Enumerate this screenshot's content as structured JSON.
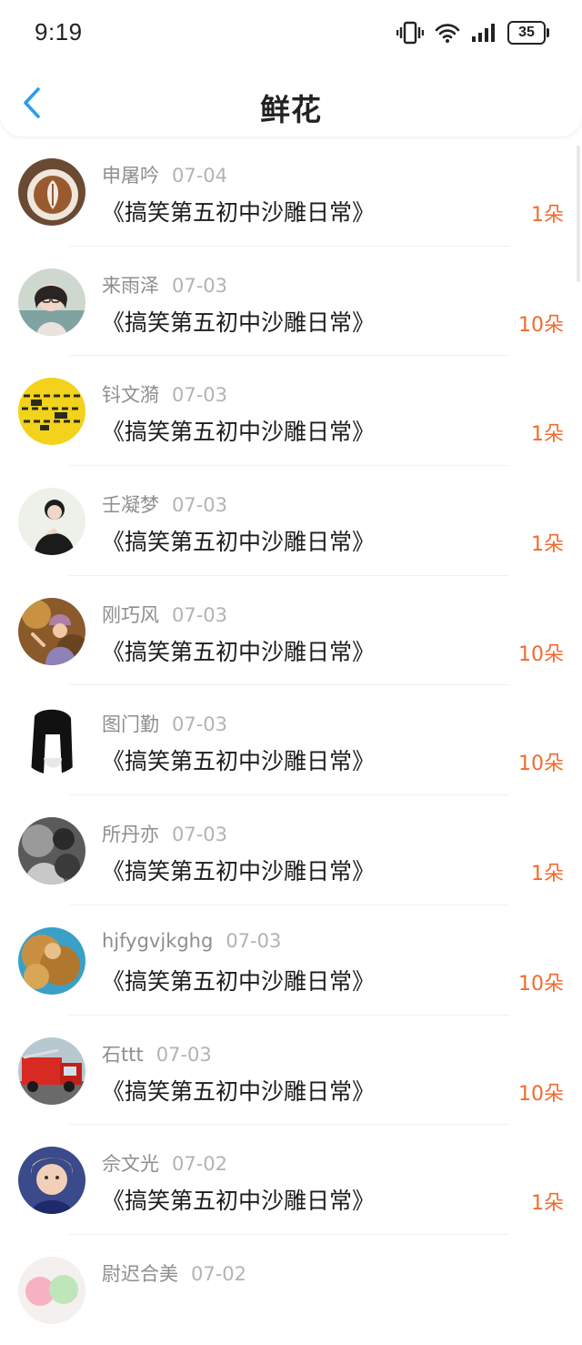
{
  "status_bar": {
    "time": "9:19",
    "battery": "35"
  },
  "header": {
    "title": "鲜花"
  },
  "items": [
    {
      "name": "申屠吟",
      "date": "07-04",
      "title": "《搞笑第五初中沙雕日常》",
      "count": "1朵",
      "avatar": "coffee-latte-art"
    },
    {
      "name": "来雨泽",
      "date": "07-03",
      "title": "《搞笑第五初中沙雕日常》",
      "count": "10朵",
      "avatar": "girl-with-glasses"
    },
    {
      "name": "钭文漪",
      "date": "07-03",
      "title": "《搞笑第五初中沙雕日常》",
      "count": "1朵",
      "avatar": "yellow-pattern"
    },
    {
      "name": "壬凝梦",
      "date": "07-03",
      "title": "《搞笑第五初中沙雕日常》",
      "count": "1朵",
      "avatar": "person-black-outfit"
    },
    {
      "name": "刚巧风",
      "date": "07-03",
      "title": "《搞笑第五初中沙雕日常》",
      "count": "10朵",
      "avatar": "girl-knit-hat"
    },
    {
      "name": "图门勤",
      "date": "07-03",
      "title": "《搞笑第五初中沙雕日常》",
      "count": "10朵",
      "avatar": "anime-sketch-girl"
    },
    {
      "name": "所丹亦",
      "date": "07-03",
      "title": "《搞笑第五初中沙雕日常》",
      "count": "1朵",
      "avatar": "grayscale-photo"
    },
    {
      "name": "hjfygvjkghg",
      "date": "07-03",
      "title": "《搞笑第五初中沙雕日常》",
      "count": "10朵",
      "avatar": "curly-hair-girl"
    },
    {
      "name": "石ttt",
      "date": "07-03",
      "title": "《搞笑第五初中沙雕日常》",
      "count": "10朵",
      "avatar": "red-fire-truck"
    },
    {
      "name": "佘文光",
      "date": "07-02",
      "title": "《搞笑第五初中沙雕日常》",
      "count": "1朵",
      "avatar": "boy-portrait"
    },
    {
      "name": "尉迟合美",
      "date": "07-02",
      "title": "",
      "count": "",
      "avatar": "pastel-balls"
    }
  ],
  "colors": {
    "accent": "#2a9df4",
    "count": "#f26a2e",
    "name": "#8e8e8e",
    "date": "#b3b3b3"
  }
}
